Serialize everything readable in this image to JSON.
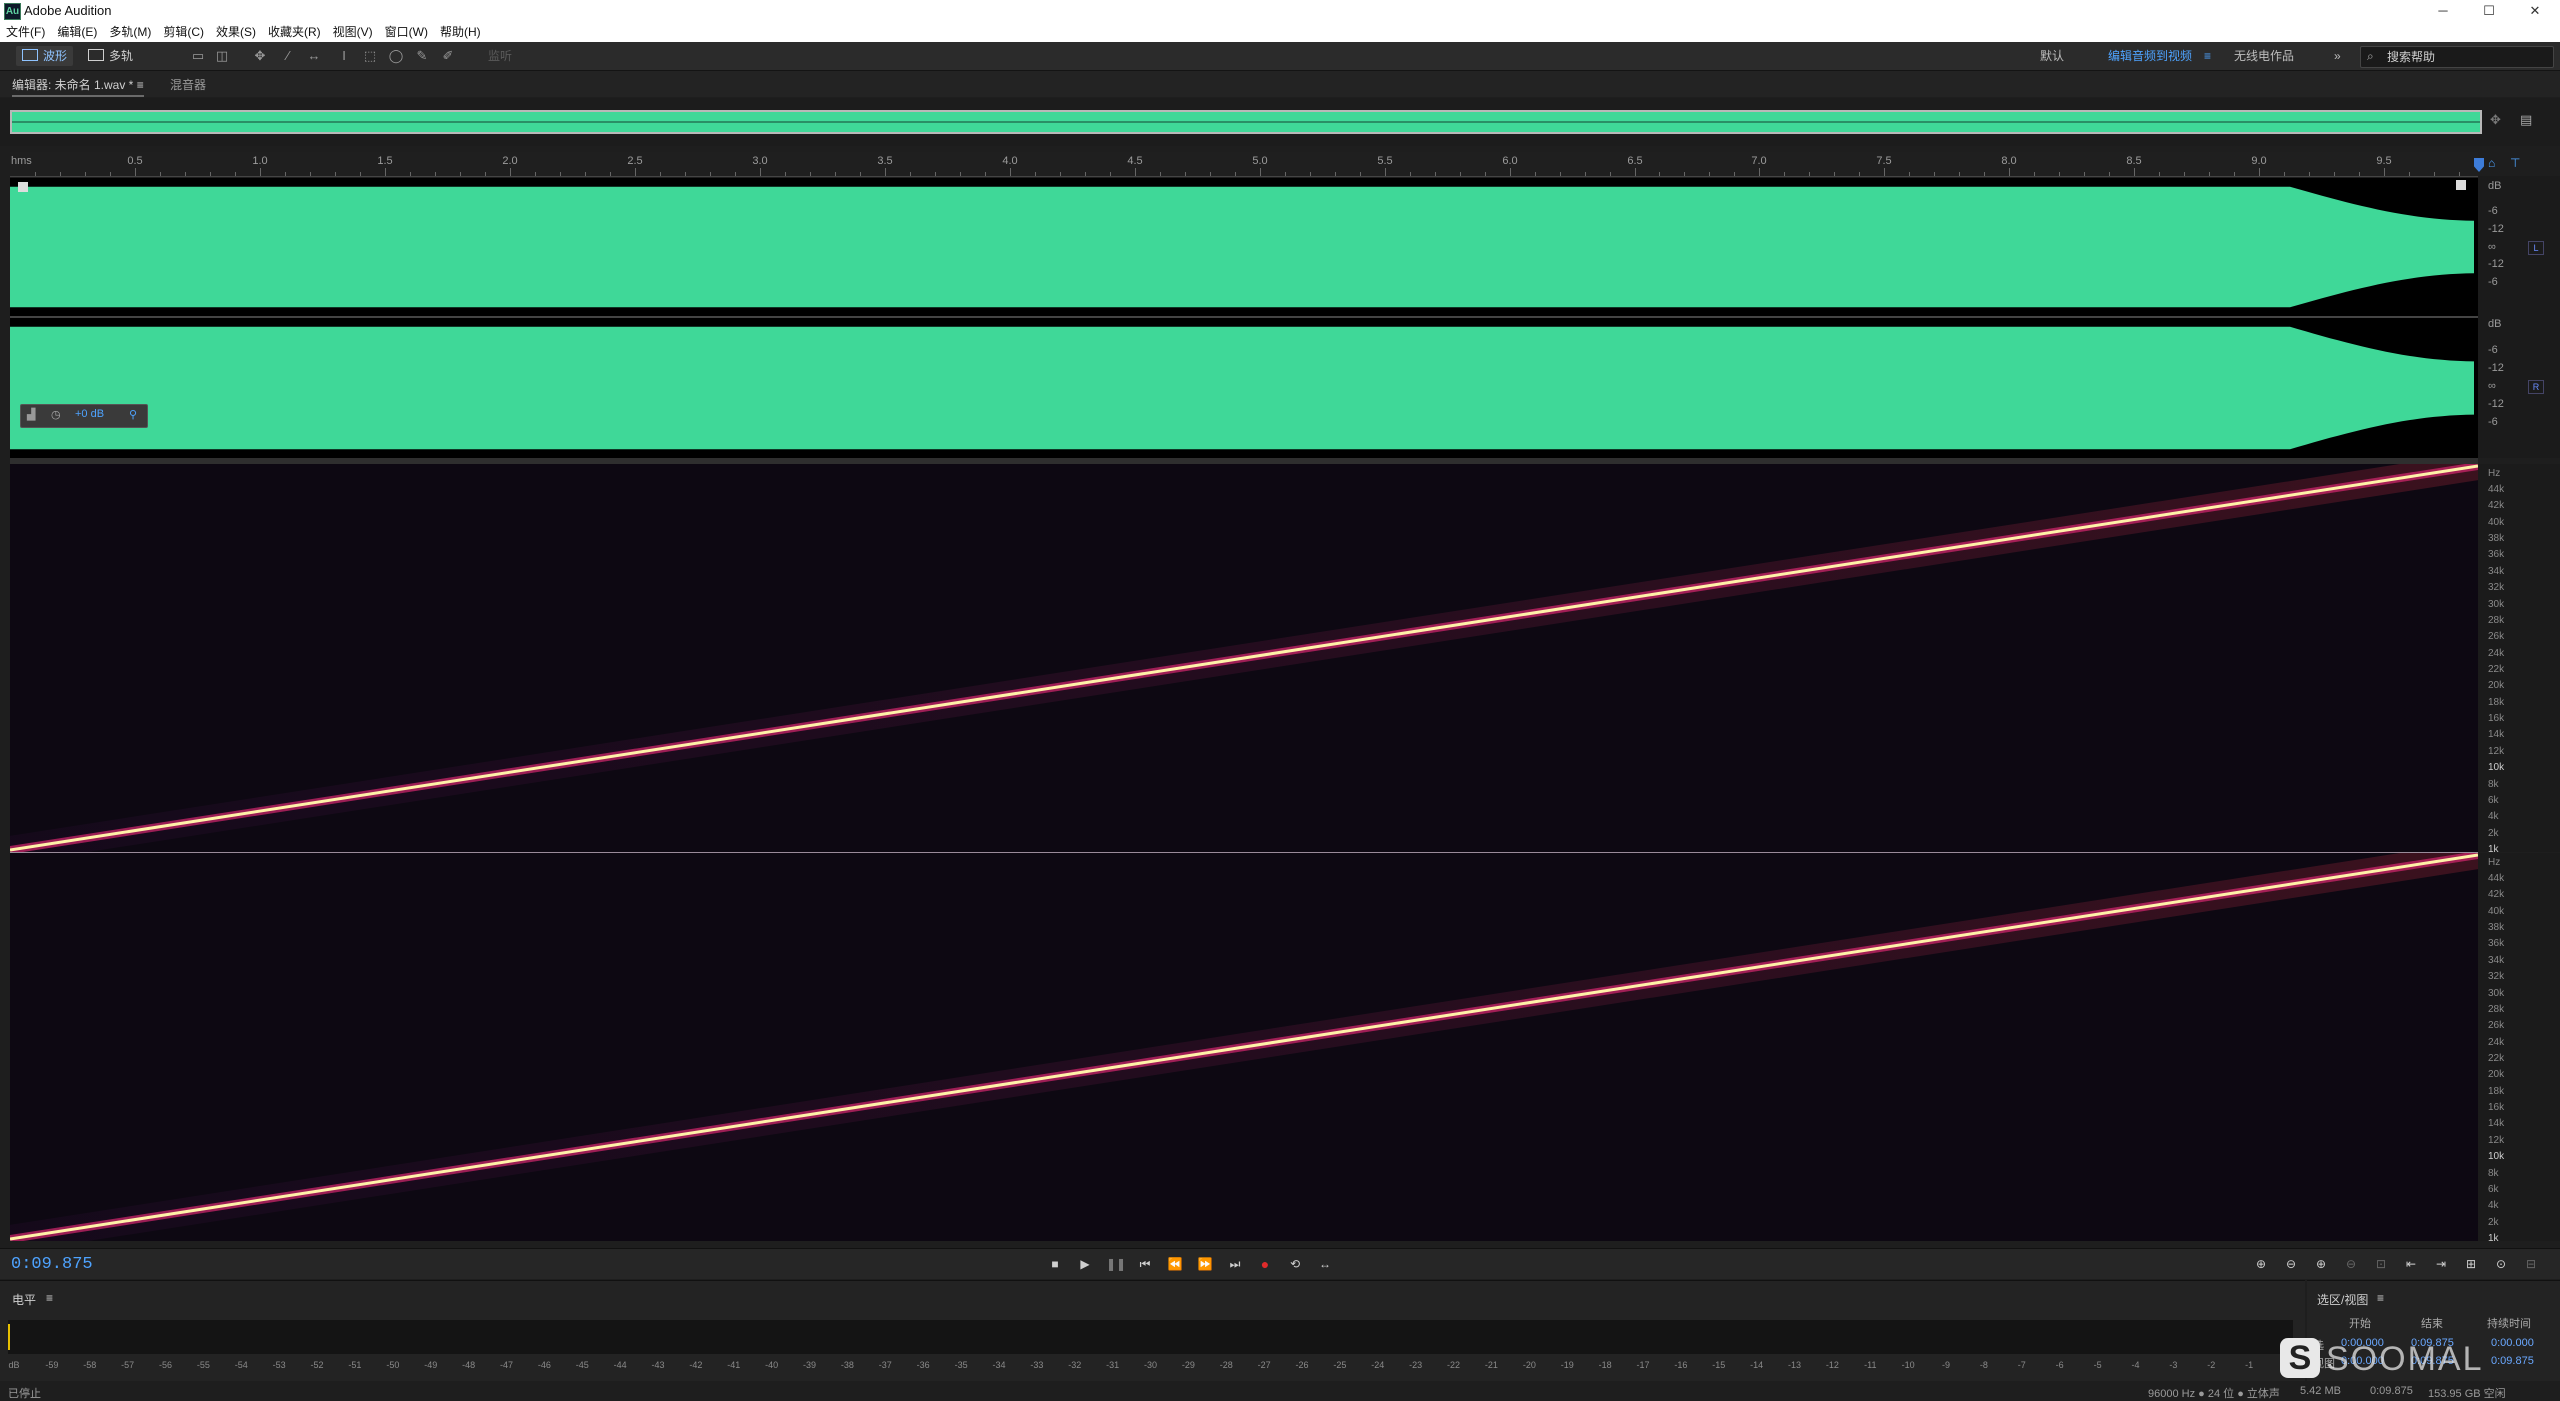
{
  "window": {
    "title": "Adobe Audition",
    "app_icon": "Au",
    "minimize": "─",
    "maximize": "☐",
    "close": "✕"
  },
  "menu": [
    "文件(F)",
    "编辑(E)",
    "多轨(M)",
    "剪辑(C)",
    "效果(S)",
    "收藏夹(R)",
    "视图(V)",
    "窗口(W)",
    "帮助(H)"
  ],
  "toolbar": {
    "waveform_label": "波形",
    "multitrack_label": "多轨",
    "disabled_label": "监听",
    "workspaces": {
      "default": "默认",
      "edit_audio_to_video": "编辑音频到视频",
      "radio_production": "无线电作品"
    },
    "more": "»",
    "search_placeholder": "搜索帮助"
  },
  "panels": {
    "editor_tab": "编辑器: 未命名 1.wav *",
    "editor_menu": "≡",
    "mixer_tab": "混音器"
  },
  "ruler": {
    "unit": "hms",
    "labels": [
      "0.5",
      "1.0",
      "1.5",
      "2.0",
      "2.5",
      "3.0",
      "3.5",
      "4.0",
      "4.5",
      "5.0",
      "5.5",
      "6.0",
      "6.5",
      "7.0",
      "7.5",
      "8.0",
      "8.5",
      "9.0",
      "9.5"
    ]
  },
  "db_scale": {
    "unit": "dB",
    "labels": [
      "-6",
      "-12",
      "∞",
      "-12",
      "-6"
    ],
    "channels": [
      "L",
      "R"
    ]
  },
  "hud": {
    "value": "+0 dB"
  },
  "hz_scale": {
    "unit": "Hz",
    "labels": [
      "44k",
      "42k",
      "40k",
      "38k",
      "36k",
      "34k",
      "32k",
      "30k",
      "28k",
      "26k",
      "24k",
      "22k",
      "20k",
      "18k",
      "16k",
      "14k",
      "12k",
      "10k",
      "8k",
      "6k",
      "4k",
      "2k",
      "1k"
    ]
  },
  "colors": {
    "waveform": "#3fd898",
    "accent": "#4ea3ff",
    "record": "#e02b2b",
    "sweep_core": "#fff2a8",
    "sweep_glow": "#ff3a52"
  },
  "transport": {
    "timecode": "0:09.875"
  },
  "level_panel": {
    "title": "电平",
    "menu": "≡",
    "scale": [
      "dB",
      "-59",
      "-58",
      "-57",
      "-56",
      "-55",
      "-54",
      "-53",
      "-52",
      "-51",
      "-50",
      "-49",
      "-48",
      "-47",
      "-46",
      "-45",
      "-44",
      "-43",
      "-42",
      "-41",
      "-40",
      "-39",
      "-38",
      "-37",
      "-36",
      "-35",
      "-34",
      "-33",
      "-32",
      "-31",
      "-30",
      "-29",
      "-28",
      "-27",
      "-26",
      "-25",
      "-24",
      "-23",
      "-22",
      "-21",
      "-20",
      "-19",
      "-18",
      "-17",
      "-16",
      "-15",
      "-14",
      "-13",
      "-12",
      "-11",
      "-10",
      "-9",
      "-8",
      "-7",
      "-6",
      "-5",
      "-4",
      "-3",
      "-2",
      "-1",
      "0"
    ]
  },
  "selection_panel": {
    "title": "选区/视图",
    "menu": "≡",
    "headers": {
      "start": "开始",
      "end": "结束",
      "duration": "持续时间"
    },
    "rows": [
      {
        "label": "选",
        "start": "0:00.000",
        "end": "0:09.875",
        "duration": "0:00.000"
      },
      {
        "label": "视图",
        "start": "0:00.000",
        "end": "0:09.875",
        "duration": "0:09.875"
      }
    ]
  },
  "status": {
    "state": "已停止",
    "sample": "96000 Hz ● 24 位 ● 立体声",
    "size": "5.42 MB",
    "duration": "0:09.875",
    "free": "153.95 GB 空闲"
  },
  "watermark": "SOOMAL"
}
